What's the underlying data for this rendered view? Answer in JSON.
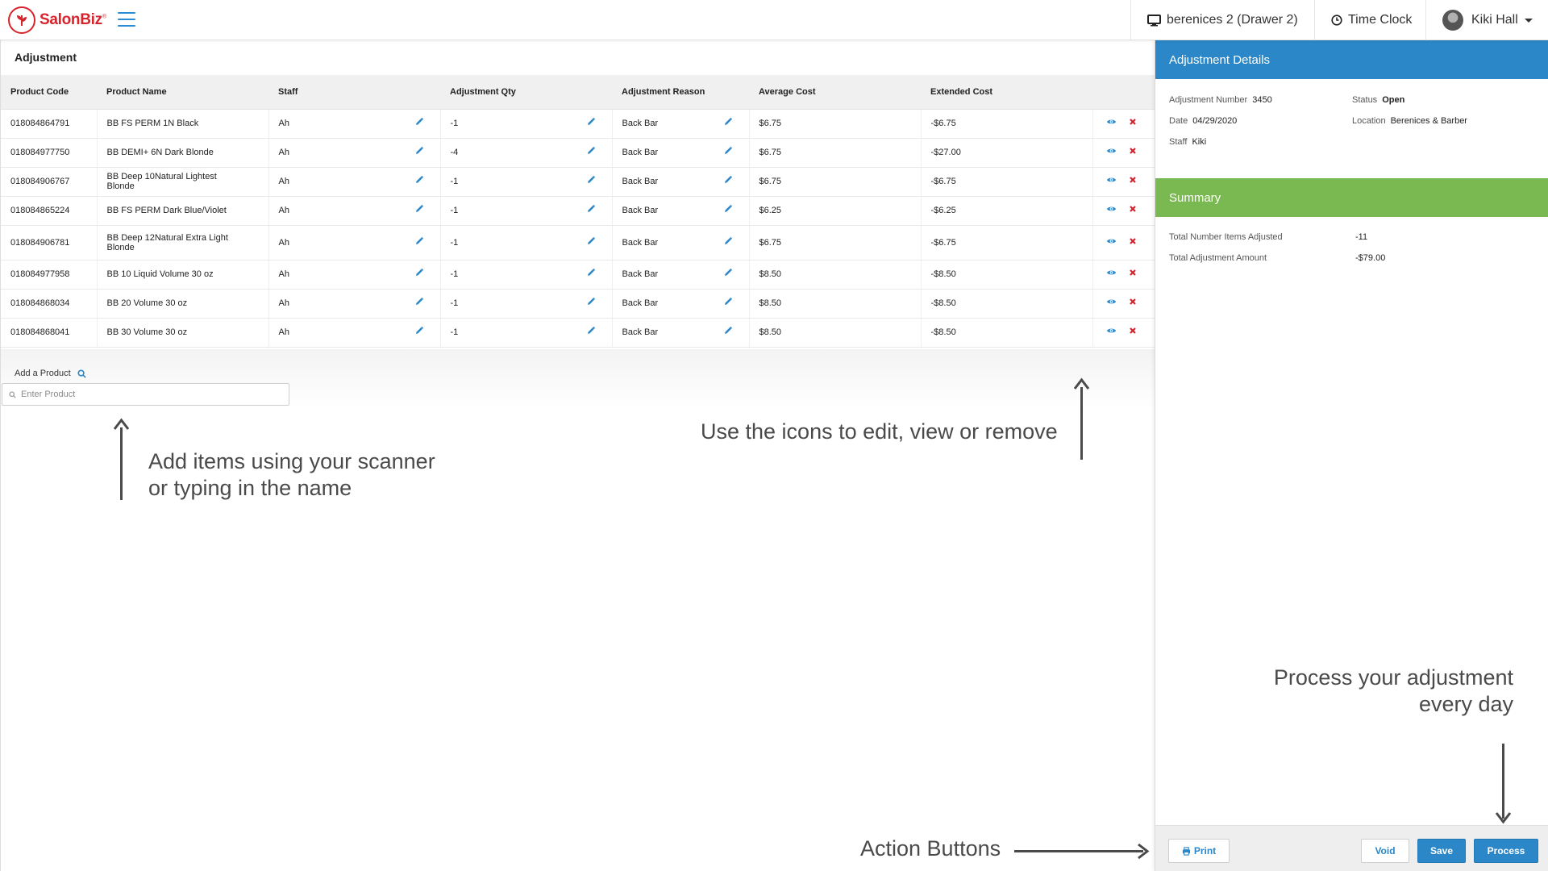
{
  "app": {
    "logo_text": "SalonBiz",
    "logo_mark": "®",
    "drawer": "berenices 2 (Drawer 2)",
    "time_clock": "Time Clock",
    "user_name": "Kiki Hall"
  },
  "page": {
    "title": "Adjustment"
  },
  "table": {
    "headers": [
      "Product Code",
      "Product Name",
      "Staff",
      "Adjustment Qty",
      "Adjustment Reason",
      "Average Cost",
      "Extended Cost"
    ],
    "rows": [
      {
        "code": "018084864791",
        "name": "BB FS PERM 1N Black",
        "staff": "Ah",
        "qty": "-1",
        "reason": "Back Bar",
        "avg": "$6.75",
        "ext": "-$6.75"
      },
      {
        "code": "018084977750",
        "name": "BB DEMI+ 6N Dark Blonde",
        "staff": "Ah",
        "qty": "-4",
        "reason": "Back Bar",
        "avg": "$6.75",
        "ext": "-$27.00"
      },
      {
        "code": "018084906767",
        "name": "BB Deep 10Natural Lightest Blonde",
        "staff": "Ah",
        "qty": "-1",
        "reason": "Back Bar",
        "avg": "$6.75",
        "ext": "-$6.75"
      },
      {
        "code": "018084865224",
        "name": "BB FS PERM Dark Blue/Violet",
        "staff": "Ah",
        "qty": "-1",
        "reason": "Back Bar",
        "avg": "$6.25",
        "ext": "-$6.25"
      },
      {
        "code": "018084906781",
        "name": "BB Deep 12Natural Extra Light Blonde",
        "staff": "Ah",
        "qty": "-1",
        "reason": "Back Bar",
        "avg": "$6.75",
        "ext": "-$6.75"
      },
      {
        "code": "018084977958",
        "name": "BB 10 Liquid Volume 30 oz",
        "staff": "Ah",
        "qty": "-1",
        "reason": "Back Bar",
        "avg": "$8.50",
        "ext": "-$8.50"
      },
      {
        "code": "018084868034",
        "name": "BB 20 Volume 30 oz",
        "staff": "Ah",
        "qty": "-1",
        "reason": "Back Bar",
        "avg": "$8.50",
        "ext": "-$8.50"
      },
      {
        "code": "018084868041",
        "name": "BB 30 Volume 30 oz",
        "staff": "Ah",
        "qty": "-1",
        "reason": "Back Bar",
        "avg": "$8.50",
        "ext": "-$8.50"
      }
    ]
  },
  "add_product": {
    "label": "Add a Product",
    "placeholder": "Enter Product"
  },
  "details": {
    "heading": "Adjustment Details",
    "number_label": "Adjustment Number",
    "number_value": "3450",
    "status_label": "Status",
    "status_value": "Open",
    "date_label": "Date",
    "date_value": "04/29/2020",
    "location_label": "Location",
    "location_value": "Berenices & Barber",
    "staff_label": "Staff",
    "staff_value": "Kiki"
  },
  "summary": {
    "heading": "Summary",
    "items_label": "Total Number Items Adjusted",
    "items_value": "-11",
    "amount_label": "Total Adjustment Amount",
    "amount_value": "-$79.00"
  },
  "buttons": {
    "print": "Print",
    "void": "Void",
    "save": "Save",
    "process": "Process"
  },
  "annotations": {
    "add_items_line1": "Add items using your scanner",
    "add_items_line2": "or typing in the name",
    "icons": "Use the icons to edit, view or remove",
    "process_line1": "Process your adjustment",
    "process_line2": "every day",
    "action_buttons": "Action Buttons"
  },
  "colors": {
    "brand_red": "#d7232c",
    "primary_blue": "#2b87c7",
    "summary_green": "#7ab851",
    "remove_red": "#d0232b"
  },
  "icons": [
    "desktop-icon",
    "clock-icon",
    "pencil-icon",
    "eye-icon",
    "remove-icon",
    "search-icon",
    "printer-icon"
  ]
}
